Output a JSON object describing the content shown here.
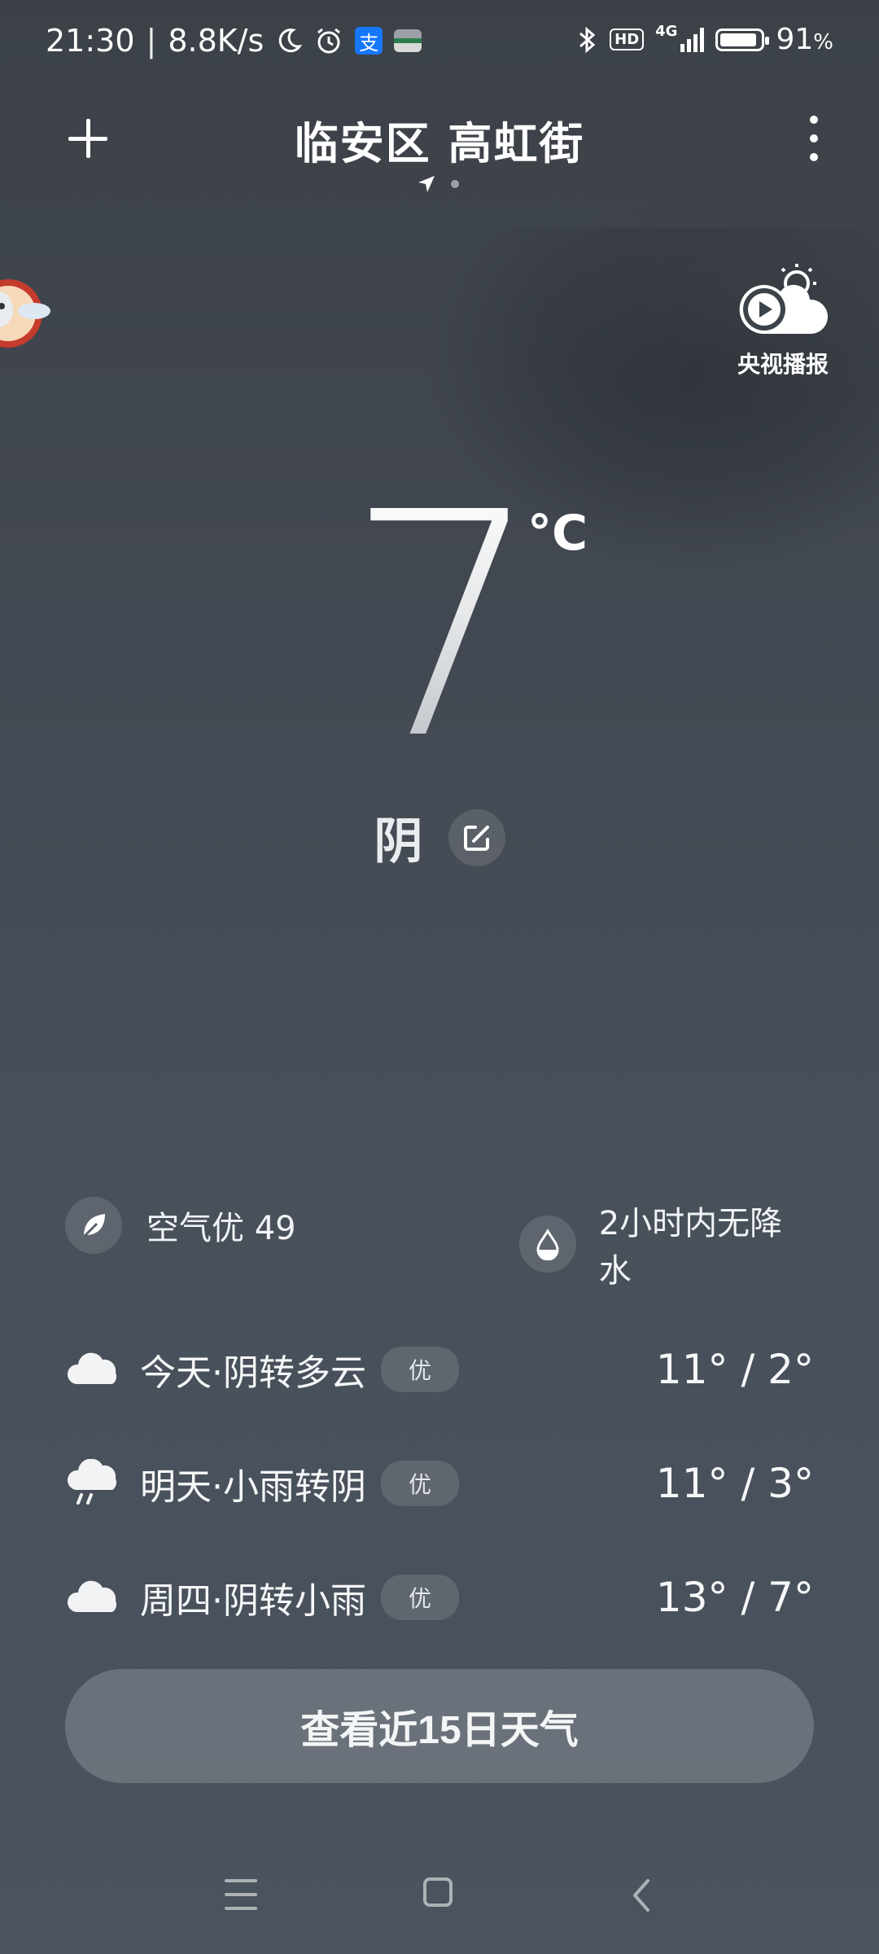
{
  "status_bar": {
    "time": "21:30",
    "speed": "8.8K/s",
    "network": "4G",
    "hd": "HD",
    "battery": "91",
    "battery_unit": "%",
    "battery_level": 0.91
  },
  "header": {
    "location": "临安区 高虹街"
  },
  "cctv": {
    "label": "央视播报"
  },
  "current": {
    "temperature": "7",
    "unit": "°C",
    "condition": "阴"
  },
  "info": {
    "air_quality": "空气优 49",
    "precipitation": "2小时内无降水"
  },
  "forecast": [
    {
      "day": "今天·阴转多云",
      "aqi": "优",
      "temps": "11° / 2°",
      "icon": "cloud-icon"
    },
    {
      "day": "明天·小雨转阴",
      "aqi": "优",
      "temps": "11° / 3°",
      "icon": "rain-icon"
    },
    {
      "day": "周四·阴转小雨",
      "aqi": "优",
      "temps": "13° / 7°",
      "icon": "cloud-icon"
    }
  ],
  "cta": {
    "label": "查看近15日天气"
  }
}
